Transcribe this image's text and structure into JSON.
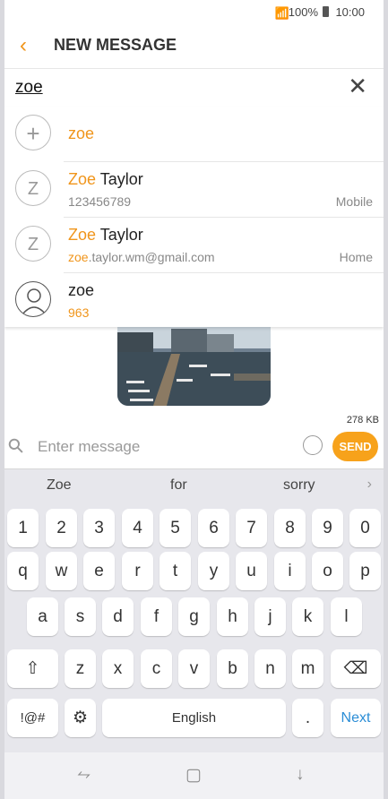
{
  "status": {
    "signal": "📶",
    "battery": "100%",
    "time": "10:00"
  },
  "header": {
    "back_icon": "‹",
    "title": "NEW MESSAGE"
  },
  "recipient": {
    "value": "zoe",
    "clear_icon": "✕"
  },
  "suggestions": [
    {
      "avatar": "+",
      "name_hl": "zoe",
      "name_rest": "",
      "sub_hl": "",
      "sub_rest": "",
      "type": ""
    },
    {
      "avatar": "Z",
      "name_hl": "Zoe",
      "name_rest": " Taylor",
      "sub_hl": "",
      "sub_rest": "123456789",
      "type": "Mobile"
    },
    {
      "avatar": "Z",
      "name_hl": "Zoe",
      "name_rest": " Taylor",
      "sub_hl": "zoe",
      "sub_rest": ".taylor.wm@gmail.com",
      "type": "Home"
    },
    {
      "avatar": "",
      "name_hl": "",
      "name_rest": "zoe",
      "sub_hl": "963",
      "sub_rest": "",
      "type": ""
    }
  ],
  "attachment": {
    "size": "278 KB"
  },
  "composer": {
    "placeholder": "Enter message",
    "send_label": "SEND"
  },
  "keyboard": {
    "predictions": [
      "Zoe",
      "for",
      "sorry"
    ],
    "pred_more": "›",
    "row_numbers": [
      "1",
      "2",
      "3",
      "4",
      "5",
      "6",
      "7",
      "8",
      "9",
      "0"
    ],
    "row1": [
      "q",
      "w",
      "e",
      "r",
      "t",
      "y",
      "u",
      "i",
      "o",
      "p"
    ],
    "row2": [
      "a",
      "s",
      "d",
      "f",
      "g",
      "h",
      "j",
      "k",
      "l"
    ],
    "row3": [
      "z",
      "x",
      "c",
      "v",
      "b",
      "n",
      "m"
    ],
    "shift": "⇧",
    "backspace": "⌫",
    "symbols": "!@#",
    "settings": "⚙",
    "space": "English",
    "period": ".",
    "next": "Next"
  },
  "navbar": {
    "recent": "⥊",
    "home": "▢",
    "back": "↓"
  },
  "colors": {
    "accent": "#f0951b",
    "send": "#f7a21b",
    "next": "#2b8dd6"
  }
}
